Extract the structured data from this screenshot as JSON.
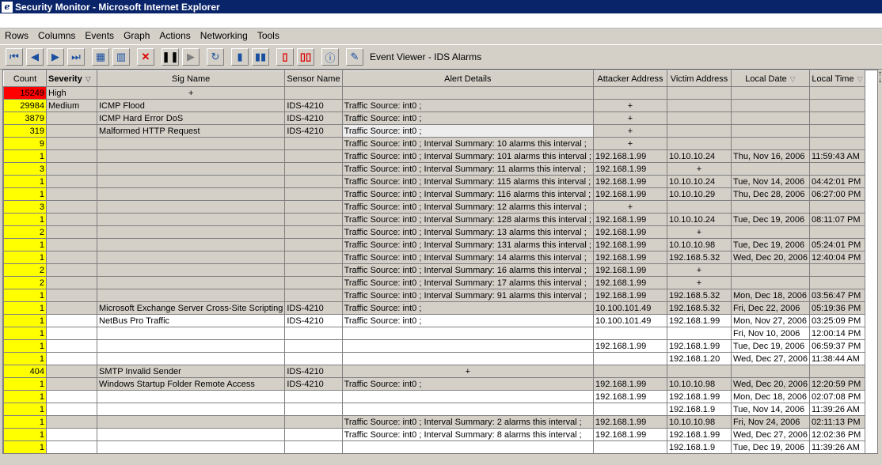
{
  "window": {
    "title": "Security Monitor - Microsoft Internet Explorer"
  },
  "menu": [
    "Rows",
    "Columns",
    "Events",
    "Graph",
    "Actions",
    "Networking",
    "Tools"
  ],
  "toolbar": {
    "view_title": "Event Viewer - IDS Alarms",
    "buttons": [
      "first-icon",
      "prev-icon",
      "next-icon",
      "last-icon",
      "table-icon",
      "columns-icon",
      "delete-icon",
      "pause-icon",
      "play-icon",
      "refresh-icon",
      "chart-icon",
      "bar-chart-icon",
      "graph-icon",
      "graph-color-icon",
      "info-icon",
      "edit-icon"
    ]
  },
  "table": {
    "headers": [
      "Count",
      "Severity",
      "Sig Name",
      "Sensor Name",
      "Alert Details",
      "Attacker Address",
      "Victim Address",
      "Local Date",
      "Local Time"
    ],
    "rows": [
      [
        "15249",
        "High",
        "+",
        "",
        "",
        "",
        "",
        "",
        ""
      ],
      [
        "29984",
        "Medium",
        "ICMP Flood",
        "IDS-4210",
        "Traffic Source: int0 ;",
        "+",
        "",
        "",
        ""
      ],
      [
        "3879",
        "",
        "ICMP Hard Error DoS",
        "IDS-4210",
        "Traffic Source: int0 ;",
        "+",
        "",
        "",
        ""
      ],
      [
        "319",
        "",
        "Malformed HTTP Request",
        "IDS-4210",
        "Traffic Source: int0 ;",
        "+",
        "",
        "",
        ""
      ],
      [
        "9",
        "",
        "",
        "",
        "Traffic Source: int0 ; Interval Summary: 10 alarms this interval ;",
        "+",
        "",
        "",
        ""
      ],
      [
        "1",
        "",
        "",
        "",
        "Traffic Source: int0 ; Interval Summary: 101 alarms this interval ;",
        "192.168.1.99",
        "10.10.10.24",
        "Thu, Nov 16, 2006",
        "11:59:43 AM"
      ],
      [
        "3",
        "",
        "",
        "",
        "Traffic Source: int0 ; Interval Summary: 11 alarms this interval ;",
        "192.168.1.99",
        "+",
        "",
        ""
      ],
      [
        "1",
        "",
        "",
        "",
        "Traffic Source: int0 ; Interval Summary: 115 alarms this interval ;",
        "192.168.1.99",
        "10.10.10.24",
        "Tue, Nov 14, 2006",
        "04:42:01 PM"
      ],
      [
        "1",
        "",
        "",
        "",
        "Traffic Source: int0 ; Interval Summary: 116 alarms this interval ;",
        "192.168.1.99",
        "10.10.10.29",
        "Thu, Dec 28, 2006",
        "06:27:00 PM"
      ],
      [
        "3",
        "",
        "",
        "",
        "Traffic Source: int0 ; Interval Summary: 12 alarms this interval ;",
        "+",
        "",
        "",
        ""
      ],
      [
        "1",
        "",
        "",
        "",
        "Traffic Source: int0 ; Interval Summary: 128 alarms this interval ;",
        "192.168.1.99",
        "10.10.10.24",
        "Tue, Dec 19, 2006",
        "08:11:07 PM"
      ],
      [
        "2",
        "",
        "",
        "",
        "Traffic Source: int0 ; Interval Summary: 13 alarms this interval ;",
        "192.168.1.99",
        "+",
        "",
        ""
      ],
      [
        "1",
        "",
        "",
        "",
        "Traffic Source: int0 ; Interval Summary: 131 alarms this interval ;",
        "192.168.1.99",
        "10.10.10.98",
        "Tue, Dec 19, 2006",
        "05:24:01 PM"
      ],
      [
        "1",
        "",
        "",
        "",
        "Traffic Source: int0 ; Interval Summary: 14 alarms this interval ;",
        "192.168.1.99",
        "192.168.5.32",
        "Wed, Dec 20, 2006",
        "12:40:04 PM"
      ],
      [
        "2",
        "",
        "",
        "",
        "Traffic Source: int0 ; Interval Summary: 16 alarms this interval ;",
        "192.168.1.99",
        "+",
        "",
        ""
      ],
      [
        "2",
        "",
        "",
        "",
        "Traffic Source: int0 ; Interval Summary: 17 alarms this interval ;",
        "192.168.1.99",
        "+",
        "",
        ""
      ],
      [
        "1",
        "",
        "",
        "",
        "Traffic Source: int0 ; Interval Summary: 91 alarms this interval ;",
        "192.168.1.99",
        "192.168.5.32",
        "Mon, Dec 18, 2006",
        "03:56:47 PM"
      ],
      [
        "1",
        "",
        "Microsoft Exchange Server Cross-Site Scripting",
        "IDS-4210",
        "Traffic Source: int0 ;",
        "10.100.101.49",
        "192.168.5.32",
        "Fri, Dec 22, 2006",
        "05:19:36 PM"
      ],
      [
        "1",
        "",
        "NetBus Pro Traffic",
        "IDS-4210",
        "Traffic Source: int0 ;",
        "10.100.101.49",
        "192.168.1.99",
        "Mon, Nov 27, 2006",
        "03:25:09 PM"
      ],
      [
        "1",
        "",
        "",
        "",
        "",
        "",
        "",
        "Fri, Nov 10, 2006",
        "12:00:14 PM"
      ],
      [
        "1",
        "",
        "",
        "",
        "",
        "192.168.1.99",
        "192.168.1.99",
        "Tue, Dec 19, 2006",
        "06:59:37 PM"
      ],
      [
        "1",
        "",
        "",
        "",
        "",
        "",
        "192.168.1.20",
        "Wed, Dec 27, 2006",
        "11:38:44 AM"
      ],
      [
        "404",
        "",
        "SMTP Invalid Sender",
        "IDS-4210",
        "+",
        "",
        "",
        "",
        ""
      ],
      [
        "1",
        "",
        "Windows Startup Folder Remote Access",
        "IDS-4210",
        "Traffic Source: int0 ;",
        "192.168.1.99",
        "10.10.10.98",
        "Wed, Dec 20, 2006",
        "12:20:59 PM"
      ],
      [
        "1",
        "",
        "",
        "",
        "",
        "192.168.1.99",
        "192.168.1.99",
        "Mon, Dec 18, 2006",
        "02:07:08 PM"
      ],
      [
        "1",
        "",
        "",
        "",
        "",
        "",
        "192.168.1.9",
        "Tue, Nov 14, 2006",
        "11:39:26 AM"
      ],
      [
        "1",
        "",
        "",
        "",
        "Traffic Source: int0 ; Interval Summary: 2 alarms this interval ;",
        "192.168.1.99",
        "10.10.10.98",
        "Fri, Nov 24, 2006",
        "02:11:13 PM"
      ],
      [
        "1",
        "",
        "",
        "",
        "Traffic Source: int0 ; Interval Summary: 8 alarms this interval ;",
        "192.168.1.99",
        "192.168.1.99",
        "Wed, Dec 27, 2006",
        "12:02:36 PM"
      ],
      [
        "1",
        "",
        "",
        "",
        "",
        "",
        "192.168.1.9",
        "Tue, Dec 19, 2006",
        "11:39:26 AM"
      ]
    ],
    "grey_rows": [
      0,
      1,
      2,
      3,
      4,
      5,
      6,
      7,
      8,
      9,
      10,
      11,
      12,
      13,
      14,
      15,
      16,
      17,
      22,
      23,
      26
    ],
    "red_count_rows": [
      0
    ]
  }
}
